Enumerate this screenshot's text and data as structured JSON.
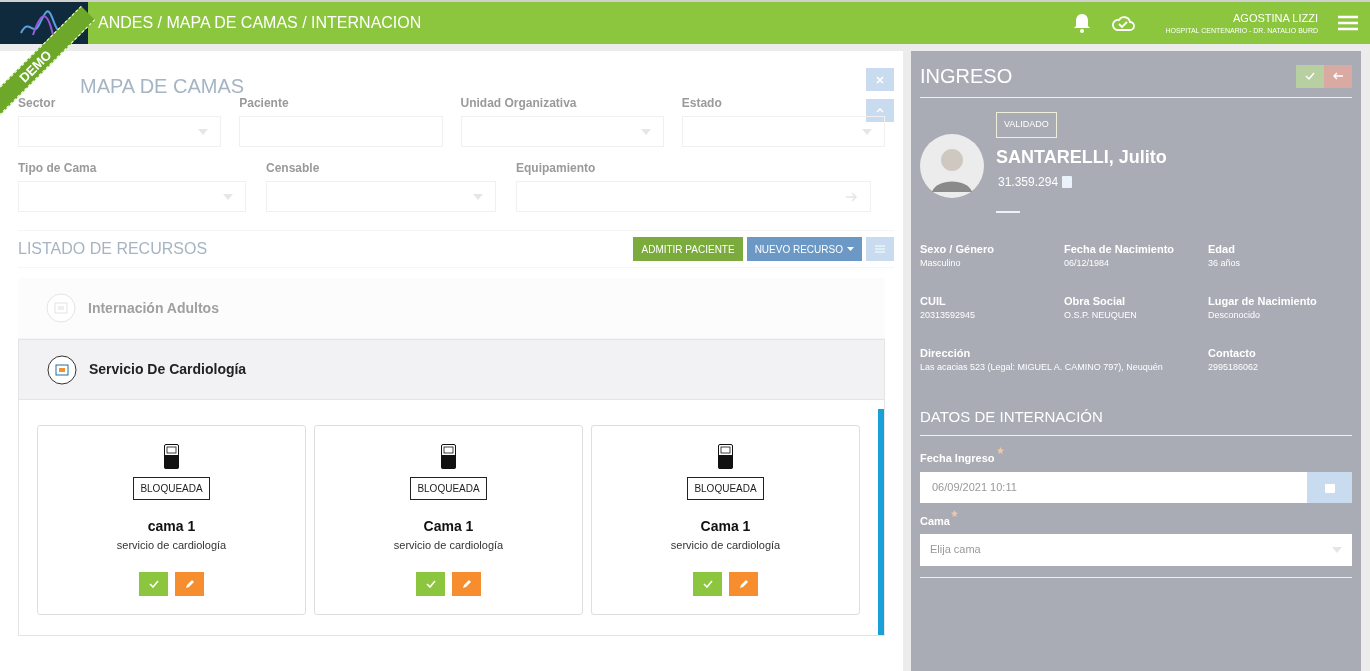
{
  "header": {
    "title": "ANDES / MAPA DE CAMAS / INTERNACION",
    "ribbon": "DEMO",
    "user": "AGOSTINA LIZZI",
    "organization": "HOSPITAL CENTENARIO - DR. NATALIO BURD"
  },
  "filters": {
    "title": "MAPA DE CAMAS",
    "rows": [
      [
        {
          "label": "Sector",
          "kind": "select"
        },
        {
          "label": "Paciente",
          "kind": "text"
        },
        {
          "label": "Unidad Organizativa",
          "kind": "select"
        },
        {
          "label": "Estado",
          "kind": "select"
        }
      ],
      [
        {
          "label": "Tipo de Cama",
          "kind": "select"
        },
        {
          "label": "Censable",
          "kind": "select"
        },
        {
          "label": "Equipamiento",
          "kind": "search"
        }
      ]
    ]
  },
  "resources": {
    "title": "LISTADO DE RECURSOS",
    "admit_button": "ADMITIR PACIENTE",
    "new_button": "NUEVO RECURSO",
    "groups": [
      {
        "name": "Internación Adultos",
        "highlighted": false
      },
      {
        "name": "Servicio De Cardiología",
        "highlighted": true,
        "beds": [
          {
            "status": "BLOQUEADA",
            "name": "cama 1",
            "service": "servicio de cardiología"
          },
          {
            "status": "BLOQUEADA",
            "name": "Cama 1",
            "service": "servicio de cardiología"
          },
          {
            "status": "BLOQUEADA",
            "name": "Cama 1",
            "service": "servicio de cardiología"
          }
        ]
      }
    ]
  },
  "admission": {
    "title": "INGRESO",
    "badge": "VALIDADO",
    "patient_name": "SANTARELLI, Julito",
    "document": "31.359.294",
    "fields": [
      {
        "label": "Sexo / Género",
        "value": "Masculino",
        "wide": false
      },
      {
        "label": "Fecha de Nacimiento",
        "value": "06/12/1984",
        "wide": false
      },
      {
        "label": "Edad",
        "value": "36 años",
        "wide": false
      },
      {
        "label": "CUIL",
        "value": "20313592945",
        "wide": false
      },
      {
        "label": "Obra Social",
        "value": "O.S.P. NEUQUEN",
        "wide": false
      },
      {
        "label": "Lugar de Nacimiento",
        "value": "Desconocido",
        "wide": false
      },
      {
        "label": "Dirección",
        "value": "Las acacias 523 (Legal: MIGUEL A. CAMINO 797), Neuquén",
        "wide": true
      },
      {
        "label": "Contacto",
        "value": "2995186062",
        "wide": false
      }
    ],
    "section_title": "DATOS DE INTERNACIÓN",
    "date_label": "Fecha Ingreso",
    "date_required": true,
    "bed_required": true,
    "date_value": "06/09/2021 10:11",
    "bed_label": "Cama",
    "bed_placeholder": "Elija cama"
  }
}
